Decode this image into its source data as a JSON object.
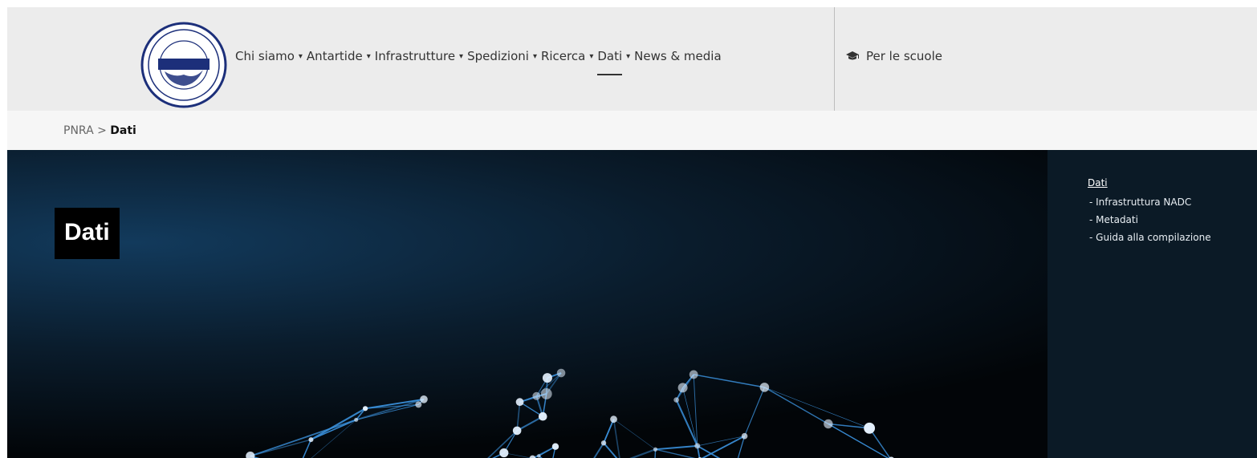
{
  "logo": {
    "ring_text": "PROGRAMMA NAZIONALE DI RICERCHE IN ANTARTIDE",
    "banner_text": "ITALIANTARTIDE"
  },
  "nav": {
    "items": [
      {
        "label": "Chi siamo",
        "dropdown": true
      },
      {
        "label": "Antartide",
        "dropdown": true
      },
      {
        "label": "Infrastrutture",
        "dropdown": true
      },
      {
        "label": "Spedizioni",
        "dropdown": true
      },
      {
        "label": "Ricerca",
        "dropdown": true
      },
      {
        "label": "Dati",
        "dropdown": true,
        "active": true
      },
      {
        "label": "News & media",
        "dropdown": false
      }
    ],
    "caret": "▾",
    "schools_label": "Per le scuole",
    "schools_icon": "graduation-cap-icon"
  },
  "breadcrumb": {
    "root": "PNRA",
    "separator": " > ",
    "current": "Dati"
  },
  "hero": {
    "title": "Dati"
  },
  "side_menu": {
    "title": "Dati",
    "items": [
      "- Infrastruttura NADC",
      "- Metadati",
      "- Guida alla compilazione"
    ]
  },
  "colors": {
    "header_bg": "#ececec",
    "breadcrumb_bg": "#f6f6f6",
    "hero_bg": "#020508",
    "network_blue": "#3a8fd9",
    "side_panel_bg": "#0b1a26"
  }
}
